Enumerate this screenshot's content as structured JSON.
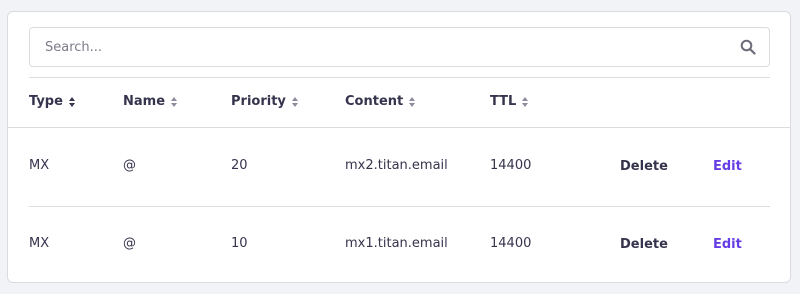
{
  "search": {
    "placeholder": "Search..."
  },
  "table": {
    "columns": [
      {
        "label": "Type",
        "sort": "active"
      },
      {
        "label": "Name",
        "sort": "neutral"
      },
      {
        "label": "Priority",
        "sort": "neutral"
      },
      {
        "label": "Content",
        "sort": "neutral"
      },
      {
        "label": "TTL",
        "sort": "neutral"
      }
    ],
    "rows": [
      {
        "type": "MX",
        "name": "@",
        "priority": "20",
        "content": "mx2.titan.email",
        "ttl": "14400"
      },
      {
        "type": "MX",
        "name": "@",
        "priority": "10",
        "content": "mx1.titan.email",
        "ttl": "14400"
      }
    ],
    "actions": {
      "delete": "Delete",
      "edit": "Edit"
    }
  },
  "colors": {
    "accent": "#673de6",
    "text": "#36344d",
    "border": "#dadce0"
  }
}
